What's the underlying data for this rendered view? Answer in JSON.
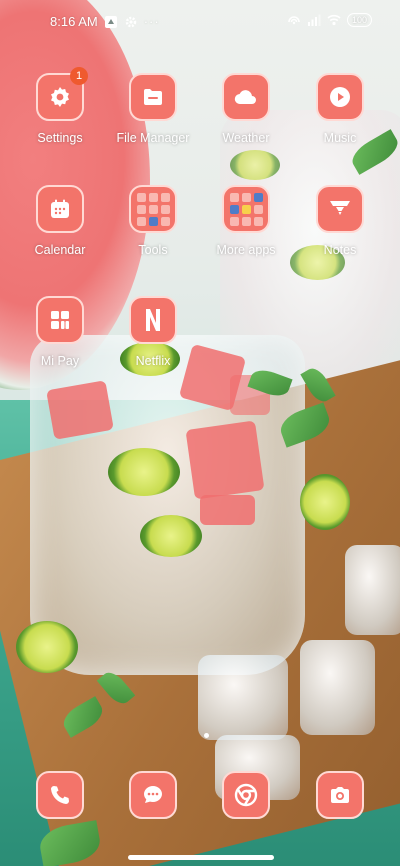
{
  "status_bar": {
    "time": "8:16 AM",
    "battery": "100"
  },
  "apps": [
    {
      "label": "Settings",
      "icon": "gear-icon",
      "badge": "1"
    },
    {
      "label": "File Manager",
      "icon": "folder-icon"
    },
    {
      "label": "Weather",
      "icon": "cloud-icon"
    },
    {
      "label": "Music",
      "icon": "play-icon"
    },
    {
      "label": "Calendar",
      "icon": "calendar-icon"
    },
    {
      "label": "Tools",
      "icon": "folder-grid-icon"
    },
    {
      "label": "More apps",
      "icon": "folder-grid-icon"
    },
    {
      "label": "Notes",
      "icon": "notes-icon"
    },
    {
      "label": "Mi Pay",
      "icon": "mipay-icon"
    },
    {
      "label": "Netflix",
      "icon": "netflix-icon"
    }
  ],
  "dock": [
    {
      "name": "phone",
      "icon": "phone-icon"
    },
    {
      "name": "messages",
      "icon": "message-icon"
    },
    {
      "name": "browser",
      "icon": "chrome-icon"
    },
    {
      "name": "camera",
      "icon": "camera-icon"
    }
  ],
  "colors": {
    "icon_bg": "#f3746a",
    "icon_border": "#ffd9d4",
    "badge": "#ef5a2f"
  }
}
